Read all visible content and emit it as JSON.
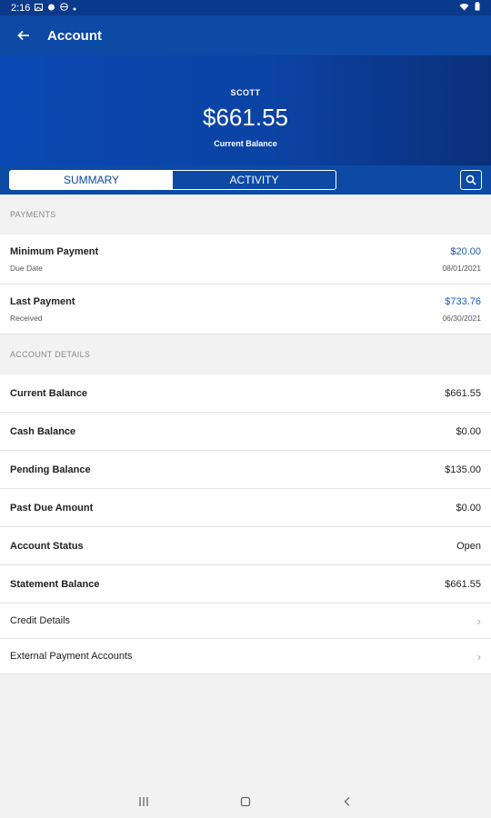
{
  "status": {
    "time": "2:16"
  },
  "header": {
    "title": "Account"
  },
  "hero": {
    "name": "SCOTT",
    "balance": "$661.55",
    "caption": "Current Balance"
  },
  "tabs": {
    "summary": "SUMMARY",
    "activity": "ACTIVITY"
  },
  "payments": {
    "heading": "PAYMENTS",
    "minimum": {
      "label": "Minimum Payment",
      "sublabel": "Due Date",
      "amount": "$20.00",
      "date": "08/01/2021"
    },
    "last": {
      "label": "Last Payment",
      "sublabel": "Received",
      "amount": "$733.76",
      "date": "06/30/2021"
    }
  },
  "details": {
    "heading": "ACCOUNT DETAILS",
    "rows": [
      {
        "label": "Current Balance",
        "value": "$661.55"
      },
      {
        "label": "Cash Balance",
        "value": "$0.00"
      },
      {
        "label": "Pending Balance",
        "value": "$135.00"
      },
      {
        "label": "Past Due Amount",
        "value": "$0.00"
      },
      {
        "label": "Account Status",
        "value": "Open"
      },
      {
        "label": "Statement Balance",
        "value": "$661.55"
      }
    ],
    "links": [
      {
        "label": "Credit Details"
      },
      {
        "label": "External Payment Accounts"
      }
    ]
  },
  "colors": {
    "primary": "#0c4aa6",
    "accent": "#1f5fb8"
  }
}
